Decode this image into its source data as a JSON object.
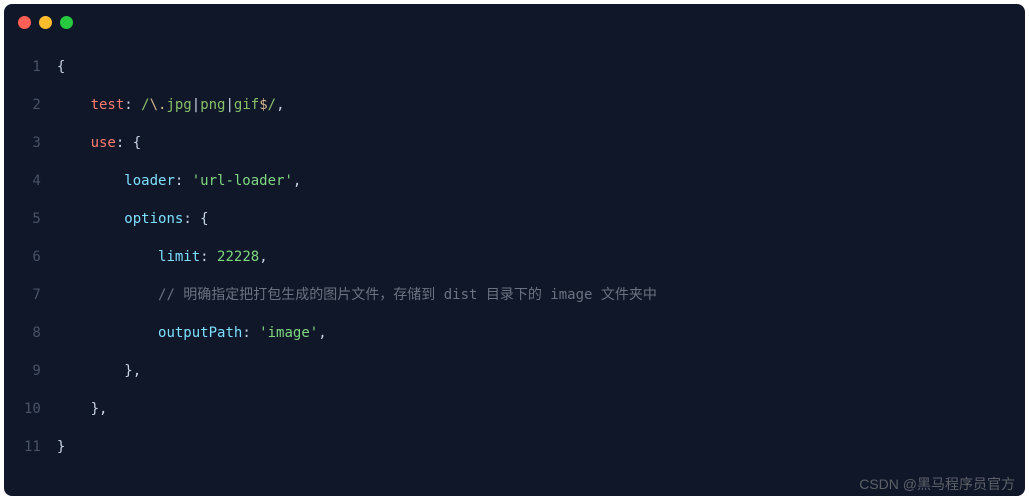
{
  "window": {
    "traffic_lights": [
      "red",
      "yellow",
      "green"
    ]
  },
  "code": {
    "lines": [
      {
        "num": "1",
        "indent": 0,
        "tokens": [
          {
            "t": "punct",
            "v": "{"
          }
        ]
      },
      {
        "num": "2",
        "indent": 1,
        "tokens": [
          {
            "t": "key-red",
            "v": "test"
          },
          {
            "t": "punct",
            "v": ": "
          },
          {
            "t": "regex",
            "v": "/"
          },
          {
            "t": "regex-alt",
            "v": "\\."
          },
          {
            "t": "regex",
            "v": "jpg"
          },
          {
            "t": "punct",
            "v": "|"
          },
          {
            "t": "regex",
            "v": "png"
          },
          {
            "t": "punct",
            "v": "|"
          },
          {
            "t": "regex",
            "v": "gif"
          },
          {
            "t": "regex-alt",
            "v": "$"
          },
          {
            "t": "regex",
            "v": "/"
          },
          {
            "t": "punct",
            "v": ","
          }
        ]
      },
      {
        "num": "3",
        "indent": 1,
        "tokens": [
          {
            "t": "key-red",
            "v": "use"
          },
          {
            "t": "punct",
            "v": ": {"
          }
        ]
      },
      {
        "num": "4",
        "indent": 2,
        "tokens": [
          {
            "t": "key-blue",
            "v": "loader"
          },
          {
            "t": "punct",
            "v": ": "
          },
          {
            "t": "string",
            "v": "'url-loader'"
          },
          {
            "t": "punct",
            "v": ","
          }
        ]
      },
      {
        "num": "5",
        "indent": 2,
        "tokens": [
          {
            "t": "key-blue",
            "v": "options"
          },
          {
            "t": "punct",
            "v": ": {"
          }
        ]
      },
      {
        "num": "6",
        "indent": 3,
        "tokens": [
          {
            "t": "key-blue",
            "v": "limit"
          },
          {
            "t": "punct",
            "v": ": "
          },
          {
            "t": "number",
            "v": "22228"
          },
          {
            "t": "punct",
            "v": ","
          }
        ]
      },
      {
        "num": "7",
        "indent": 3,
        "tokens": [
          {
            "t": "comment",
            "v": "// 明确指定把打包生成的图片文件，存储到 dist 目录下的 image 文件夹中"
          }
        ]
      },
      {
        "num": "8",
        "indent": 3,
        "tokens": [
          {
            "t": "key-blue",
            "v": "outputPath"
          },
          {
            "t": "punct",
            "v": ": "
          },
          {
            "t": "string",
            "v": "'image'"
          },
          {
            "t": "punct",
            "v": ","
          }
        ]
      },
      {
        "num": "9",
        "indent": 2,
        "tokens": [
          {
            "t": "punct",
            "v": "},"
          }
        ]
      },
      {
        "num": "10",
        "indent": 1,
        "tokens": [
          {
            "t": "punct",
            "v": "},"
          }
        ]
      },
      {
        "num": "11",
        "indent": 0,
        "tokens": [
          {
            "t": "punct",
            "v": "}"
          }
        ]
      }
    ]
  },
  "watermark": "CSDN @黑马程序员官方"
}
